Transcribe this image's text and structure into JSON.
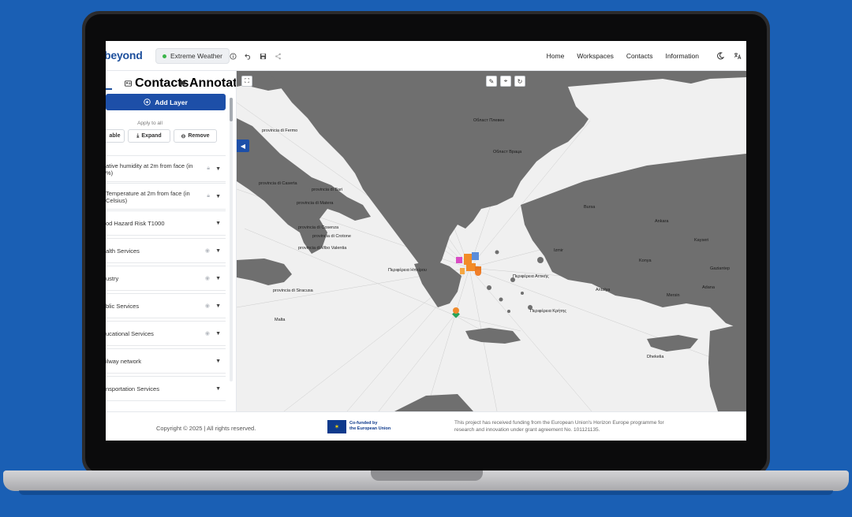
{
  "header": {
    "logo": "beyond",
    "workspace_chip": "Extreme Weather",
    "nav": [
      "Home",
      "Workspaces",
      "Contacts",
      "Information"
    ],
    "icons": [
      "info-icon",
      "undo-icon",
      "save-icon",
      "share-icon",
      "theme-toggle-icon",
      "translate-icon"
    ]
  },
  "sidebar": {
    "tabs": [
      {
        "label": "Contacts",
        "icon": "contacts-icon"
      },
      {
        "label": "Annotations",
        "icon": "annotations-icon"
      }
    ],
    "add_layer": "Add Layer",
    "apply_to_all": "Apply to all",
    "apply_buttons": [
      "able",
      "Expand",
      "Remove"
    ],
    "layers": [
      {
        "title": "ative humidity at 2m from face (in %)",
        "locked": true
      },
      {
        "title": "Temperature at 2m from face (in Celsius)",
        "locked": true
      },
      {
        "title": "od Hazard Risk T1000",
        "locked": false
      },
      {
        "title": "alth Services",
        "visible": true
      },
      {
        "title": "ustry",
        "visible": true
      },
      {
        "title": "blic Services",
        "visible": true
      },
      {
        "title": "ucational Services",
        "visible": true
      },
      {
        "title": "ilway network",
        "visible": false
      },
      {
        "title": "nsportation Services",
        "visible": false
      }
    ]
  },
  "map": {
    "tools": [
      "draw-icon",
      "lasso-icon",
      "rotate-icon"
    ],
    "labels": [
      "provincia di Fermo",
      "provincia di Caserta",
      "provincia di Bari",
      "provincia di Matera",
      "provincia di Cosenza",
      "provincia di Crotone",
      "provincia di Vibo Valentia",
      "provincia di Siracusa",
      "Malta",
      "Περιφέρεια Ηπείρου",
      "Περιφέρεια Αττικής",
      "Περιφέρεια Κρήτης",
      "Област Плевен",
      "Област Враца",
      "Ankara",
      "Konya",
      "Kayseri",
      "Adana",
      "Mersin",
      "Antalya",
      "Izmir",
      "Bursa",
      "Dhekelia",
      "Gaziantep"
    ]
  },
  "footer": {
    "copyright": "Copyright © 2025 | All rights reserved.",
    "eu_line1": "Co-funded by",
    "eu_line2": "the European Union",
    "funding_line1": "This project has received funding from the European Union's Horizon Europe programme for",
    "funding_line2": "research and innovation under grant agreement No. 101121135."
  }
}
